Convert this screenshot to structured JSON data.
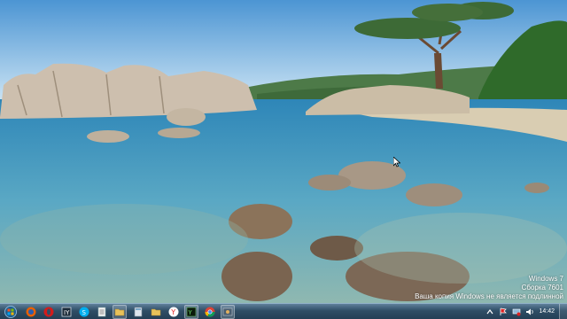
{
  "watermark": {
    "os_name": "Windows 7",
    "build": "Сборка 7601",
    "notice": "Ваша копия Windows не является подлинной"
  },
  "taskbar": {
    "clock": "14:42",
    "pinned": [
      {
        "name": "start-orb-icon"
      },
      {
        "name": "firefox-icon"
      },
      {
        "name": "opera-icon"
      },
      {
        "name": "app-window-icon"
      },
      {
        "name": "skype-icon"
      },
      {
        "name": "document-icon"
      },
      {
        "name": "folder-icon"
      },
      {
        "name": "calculator-icon"
      },
      {
        "name": "folder-icon"
      },
      {
        "name": "yandex-browser-icon"
      },
      {
        "name": "terminal-icon"
      },
      {
        "name": "chrome-icon"
      },
      {
        "name": "media-icon"
      }
    ]
  },
  "colors": {
    "taskbar": "#2f4e66",
    "sky_top": "#5aa3dc",
    "water": "#3f8fb0"
  }
}
